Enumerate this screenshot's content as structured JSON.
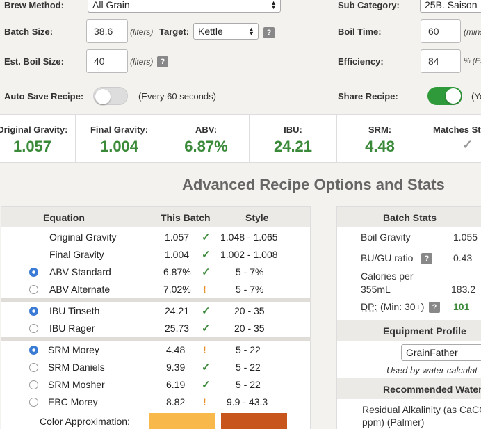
{
  "form": {
    "brew_method_label": "Brew Method:",
    "brew_method_value": "All Grain",
    "sub_category_label": "Sub Category:",
    "sub_category_value": "25B. Saison",
    "batch_size_label": "Batch Size:",
    "batch_size_value": "38.6",
    "batch_size_unit": "(liters)",
    "target_label": "Target:",
    "target_value": "Kettle",
    "boil_time_label": "Boil Time:",
    "boil_time_value": "60",
    "boil_time_unit": "(mins)",
    "est_boil_label": "Est. Boil Size:",
    "est_boil_value": "40",
    "est_boil_unit": "(liters)",
    "efficiency_label": "Efficiency:",
    "efficiency_value": "84",
    "efficiency_unit": "% (Est)",
    "auto_save_label": "Auto Save Recipe:",
    "auto_save_note": "(Every 60 seconds)",
    "share_label": "Share Recipe:",
    "share_note": "(Yo",
    "help": "?"
  },
  "stats": [
    {
      "label": "Original Gravity:",
      "value": "1.057"
    },
    {
      "label": "Final Gravity:",
      "value": "1.004"
    },
    {
      "label": "ABV:",
      "value": "6.87%"
    },
    {
      "label": "IBU:",
      "value": "24.21"
    },
    {
      "label": "SRM:",
      "value": "4.48"
    },
    {
      "label": "Matches Style:",
      "value": "✓"
    }
  ],
  "heading": "Advanced Recipe Options and Stats",
  "table": {
    "headers": {
      "equation": "Equation",
      "batch": "This Batch",
      "style": "Style"
    },
    "rows": [
      {
        "name": "Original Gravity",
        "batch": "1.057",
        "mark": "✓",
        "style": "1.048 - 1.065"
      },
      {
        "name": "Final Gravity",
        "batch": "1.004",
        "mark": "✓",
        "style": "1.002 - 1.008"
      },
      {
        "name": "ABV Standard",
        "batch": "6.87%",
        "mark": "✓",
        "style": "5 - 7%"
      },
      {
        "name": "ABV Alternate",
        "batch": "7.02%",
        "mark": "!",
        "style": "5 - 7%"
      },
      {
        "name": "IBU Tinseth",
        "batch": "24.21",
        "mark": "✓",
        "style": "20 - 35"
      },
      {
        "name": "IBU Rager",
        "batch": "25.73",
        "mark": "✓",
        "style": "20 - 35"
      },
      {
        "name": "SRM Morey",
        "batch": "4.48",
        "mark": "!",
        "style": "5 - 22"
      },
      {
        "name": "SRM Daniels",
        "batch": "9.39",
        "mark": "✓",
        "style": "5 - 22"
      },
      {
        "name": "SRM Mosher",
        "batch": "6.19",
        "mark": "✓",
        "style": "5 - 22"
      },
      {
        "name": "EBC Morey",
        "batch": "8.82",
        "mark": "!",
        "style": "9.9 - 43.3"
      }
    ],
    "color_label": "Color Approximation:",
    "color_batch": "#f9b84a",
    "color_style": "#c8561c"
  },
  "batch_stats": {
    "title": "Batch Stats",
    "boil_gravity_label": "Boil Gravity",
    "boil_gravity_value": "1.055",
    "bugu_label": "BU/GU ratio",
    "bugu_value": "0.43",
    "calories_label_1": "Calories per",
    "calories_label_2": "355mL",
    "calories_value": "183.2",
    "dp_label": "DP:",
    "dp_min": "(Min: 30+)",
    "dp_value": "101",
    "equipment_title": "Equipment Profile",
    "equipment_value": "GrainFather",
    "equipment_note": "Used by water calculat",
    "water_title": "Recommended Water",
    "residual_1": "Residual Alkalinity (as CaCO",
    "residual_2": "ppm) (Palmer)"
  },
  "colors": {
    "green": "#3a8a3a",
    "warn": "#e8902a",
    "toggle_on": "#2e9a3a",
    "toggle_off": "#dddddd"
  }
}
